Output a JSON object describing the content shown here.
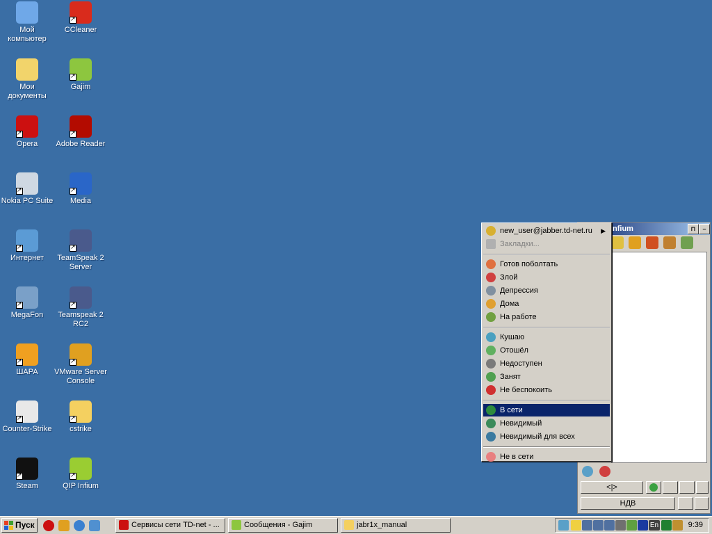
{
  "desktop": {
    "icons": [
      {
        "label": "Мой компьютер",
        "icon": "my-computer-icon",
        "color": "#6fa8e8"
      },
      {
        "label": "CCleaner",
        "icon": "ccleaner-icon",
        "color": "#d92b1c"
      },
      {
        "label": "Мои документы",
        "icon": "my-documents-icon",
        "color": "#f2d46b"
      },
      {
        "label": "Gajim",
        "icon": "gajim-icon",
        "color": "#8dc63f"
      },
      {
        "label": "Opera",
        "icon": "opera-icon",
        "color": "#cc1010"
      },
      {
        "label": "Adobe Reader",
        "icon": "adobe-reader-icon",
        "color": "#b30b00"
      },
      {
        "label": "Nokia PC Suite",
        "icon": "nokia-pc-suite-icon",
        "color": "#cfd8e2"
      },
      {
        "label": "Media",
        "icon": "media-player-icon",
        "color": "#2a66c8"
      },
      {
        "label": "Интернет",
        "icon": "internet-icon",
        "color": "#5b9bd5"
      },
      {
        "label": "TeamSpeak 2 Server",
        "icon": "teamspeak-icon",
        "color": "#4a5a8c"
      },
      {
        "label": "MegaFon",
        "icon": "megafon-icon",
        "color": "#7aa0c8"
      },
      {
        "label": "Teamspeak 2 RC2",
        "icon": "teamspeak-icon",
        "color": "#4a5a8c"
      },
      {
        "label": "ШАРА",
        "icon": "shara-icon",
        "color": "#f0a020"
      },
      {
        "label": "VMware Server Console",
        "icon": "vmware-icon",
        "color": "#e0a020"
      },
      {
        "label": "Counter-Strike",
        "icon": "counter-strike-icon",
        "color": "#e8e8e8"
      },
      {
        "label": "cstrike",
        "icon": "folder-icon",
        "color": "#f4d060"
      },
      {
        "label": "Steam",
        "icon": "steam-icon",
        "color": "#111111"
      },
      {
        "label": "QIP Infium",
        "icon": "qip-icon",
        "color": "#9acd32"
      }
    ]
  },
  "qip_window": {
    "title_fragment": "nfium",
    "bottom_button_label": "НДВ"
  },
  "context_menu": {
    "account": "new_user@jabber.td-net.ru",
    "bookmarks": "Закладки...",
    "groups": [
      [
        {
          "label": "Готов поболтать",
          "icon": "free-for-chat-status-icon",
          "color": "#e07040"
        },
        {
          "label": "Злой",
          "icon": "angry-status-icon",
          "color": "#d04040"
        },
        {
          "label": "Депрессия",
          "icon": "depression-status-icon",
          "color": "#8090a0"
        },
        {
          "label": "Дома",
          "icon": "at-home-status-icon",
          "color": "#e0a030"
        },
        {
          "label": "На работе",
          "icon": "at-work-status-icon",
          "color": "#70a040"
        }
      ],
      [
        {
          "label": "Кушаю",
          "icon": "eating-status-icon",
          "color": "#4aa0c0"
        },
        {
          "label": "Отошёл",
          "icon": "away-status-icon",
          "color": "#60b060"
        },
        {
          "label": "Недоступен",
          "icon": "not-available-status-icon",
          "color": "#7a7a7a"
        },
        {
          "label": "Занят",
          "icon": "busy-status-icon",
          "color": "#50a050"
        },
        {
          "label": "Не беспокоить",
          "icon": "do-not-disturb-status-icon",
          "color": "#d03030"
        }
      ],
      [
        {
          "label": "В сети",
          "icon": "online-status-icon",
          "color": "#2e8b3e",
          "selected": true
        },
        {
          "label": "Невидимый",
          "icon": "invisible-status-icon",
          "color": "#3a8a5a"
        },
        {
          "label": "Невидимый для всех",
          "icon": "invisible-for-all-status-icon",
          "color": "#3a7aa0"
        }
      ],
      [
        {
          "label": "Не в сети",
          "icon": "offline-status-icon",
          "color": "#e88080"
        }
      ]
    ]
  },
  "taskbar": {
    "start_label": "Пуск",
    "tasks": [
      {
        "label": "Сервисы сети TD-net - ...",
        "icon": "opera-icon",
        "color": "#cc1010"
      },
      {
        "label": "Сообщения - Gajim",
        "icon": "gajim-icon",
        "color": "#8dc63f"
      },
      {
        "label": "jabr1x_manual",
        "icon": "folder-icon",
        "color": "#f4d060"
      }
    ],
    "tray_lang": "En",
    "clock": "9:39"
  },
  "colors": {
    "desktop": "#3a6ea5",
    "selection": "#0a246a",
    "face": "#d4d0c8"
  }
}
